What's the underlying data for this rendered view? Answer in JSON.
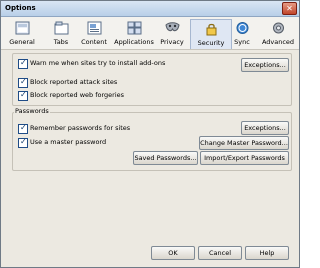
{
  "window": {
    "title": "Options"
  },
  "tabs": [
    {
      "label": "General"
    },
    {
      "label": "Tabs"
    },
    {
      "label": "Content"
    },
    {
      "label": "Applications"
    },
    {
      "label": "Privacy"
    },
    {
      "label": "Security"
    },
    {
      "label": "Sync"
    },
    {
      "label": "Advanced"
    }
  ],
  "security": {
    "warn_addons": "Warn me when sites try to install add-ons",
    "block_attack": "Block reported attack sites",
    "block_forgeries": "Block reported web forgeries",
    "exceptions_1": "Exceptions..."
  },
  "passwords": {
    "legend": "Passwords",
    "remember": "Remember passwords for sites",
    "master": "Use a master password",
    "exceptions_2": "Exceptions...",
    "change_master": "Change Master Password...",
    "saved": "Saved Passwords...",
    "import_export": "Import/Export Passwords"
  },
  "footer": {
    "ok": "OK",
    "cancel": "Cancel",
    "help": "Help"
  }
}
